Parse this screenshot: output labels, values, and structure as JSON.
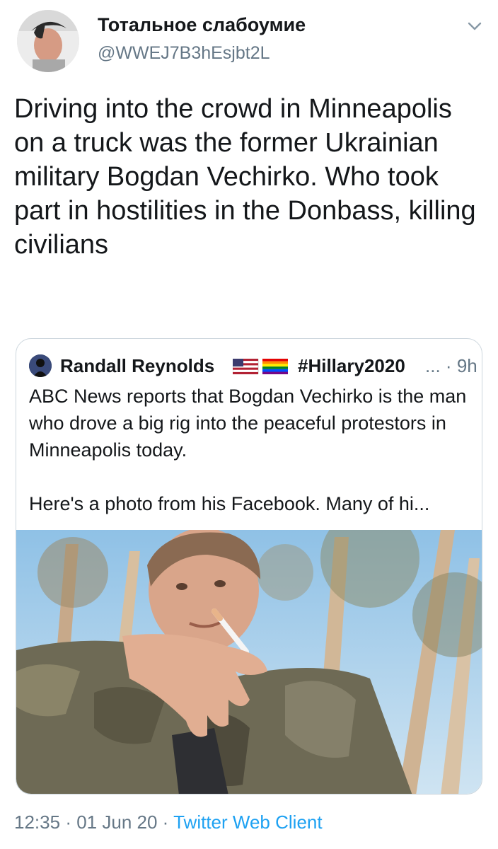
{
  "author": {
    "display_name": "Тотальное слабоумие",
    "handle": "@WWEJ7B3hEsjbt2L",
    "avatar_icon": "profile-avatar"
  },
  "tweet": {
    "text": "Driving into the crowd in Minneapolis on a truck was the former Ukrainian military Bogdan Vechirko. Who took part in hostilities in the Donbass, killing civilians"
  },
  "quoted": {
    "display_name": "Randall Reynolds",
    "flags": [
      "us-flag",
      "rainbow-flag"
    ],
    "hashtag": "#Hillary2020",
    "ellipsis": "...",
    "separator": "·",
    "time_ago": "9h",
    "text": "ABC News reports that Bogdan Vechirko is the man who drove a big rig into the peaceful protestors in Minneapolis today.\n\nHere's a photo from his Facebook. Many of hi..."
  },
  "footer": {
    "time": "12:35",
    "date": "01 Jun 20",
    "sep": "·",
    "client": "Twitter Web Client"
  },
  "colors": {
    "text": "#14171a",
    "secondary": "#657786",
    "link": "#1da1f2",
    "border": "#ccd6dd"
  }
}
